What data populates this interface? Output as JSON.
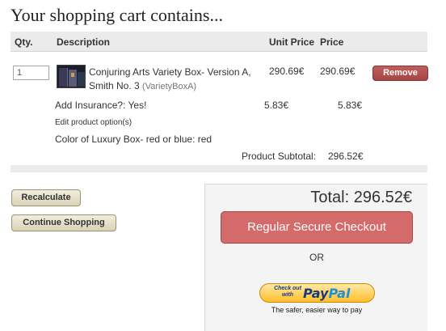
{
  "header": {
    "title": "Your shopping cart contains..."
  },
  "table": {
    "columns": {
      "qty": "Qty.",
      "description": "Description",
      "unit_price": "Unit Price",
      "price": "Price"
    }
  },
  "item": {
    "qty": "1",
    "thumbnail_icon": "product-box-image",
    "name": "Conjuring Arts Variety Box- Version A, Smith No. 3",
    "model": "(VarietyBoxA)",
    "unit_price": "290.69€",
    "price": "290.69€",
    "remove_label": "Remove",
    "insurance": {
      "label": "Add Insurance?: Yes!",
      "unit_price": "5.83€",
      "price": "5.83€"
    },
    "edit_options_label": "Edit product option(s)",
    "color_option": "Color of Luxury Box- red or blue: red"
  },
  "subtotal": {
    "label": "Product Subtotal:",
    "value": "296.52€"
  },
  "actions": {
    "recalculate": "Recalculate",
    "continue_shopping": "Continue Shopping"
  },
  "checkout": {
    "total": "Total: 296.52€",
    "secure_checkout": "Regular Secure Checkout",
    "or": "OR",
    "paypal_checkout_prefix": "Check out with",
    "paypal_logo_pay": "Pay",
    "paypal_logo_pal": "Pal",
    "paypal_tagline": "The safer, easier way to pay"
  },
  "colors": {
    "remove_button": "#b04d4d",
    "checkout_button": "#d46a6a",
    "tan_button": "#e6dfc7",
    "header_bg": "#ebebeb",
    "paypal_gold": "#ffbf2a"
  }
}
